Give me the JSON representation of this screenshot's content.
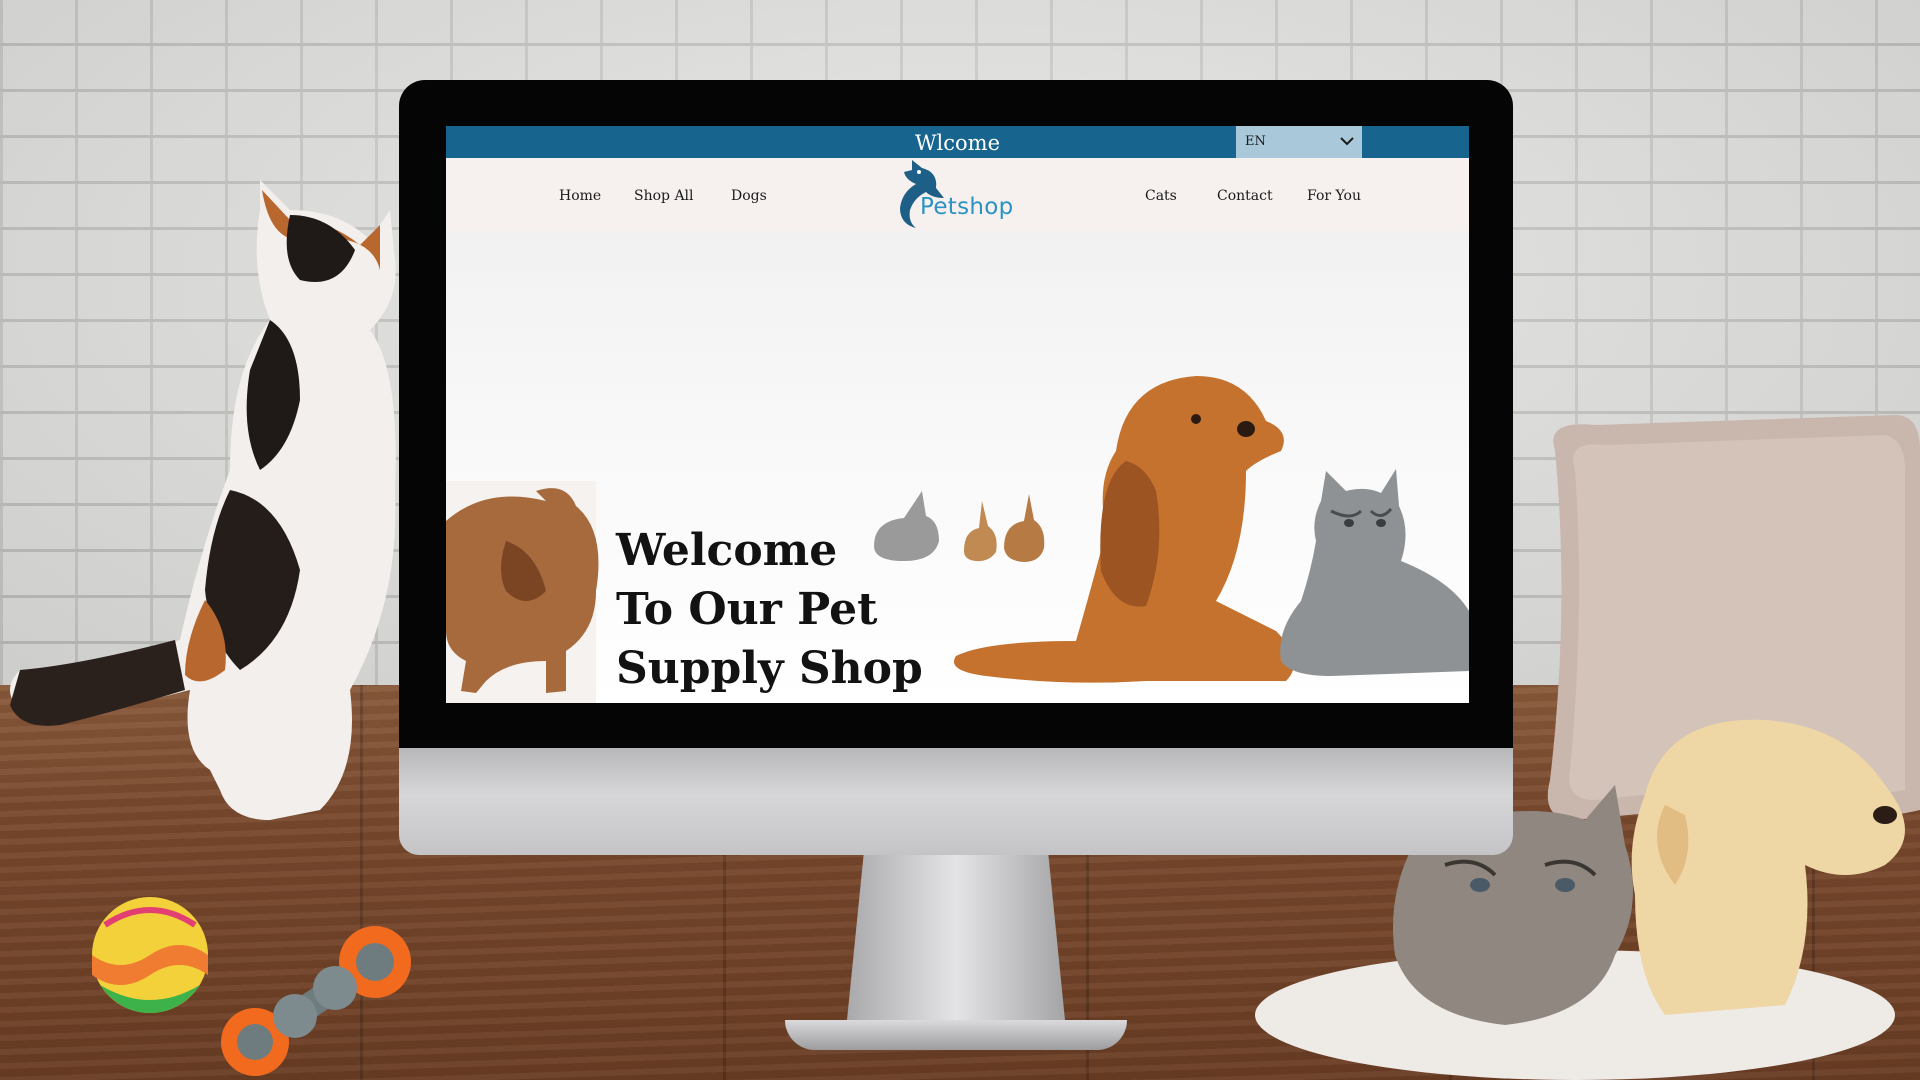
{
  "topbar": {
    "title": "Wlcome"
  },
  "language": {
    "selected": "EN"
  },
  "nav": {
    "left": [
      "Home",
      "Shop All",
      "Dogs"
    ],
    "right": [
      "Cats",
      "Contact",
      "For You"
    ]
  },
  "logo": {
    "text": "Petshop"
  },
  "hero": {
    "lines": [
      "Welcome",
      "To Our Pet",
      "Supply Shop"
    ]
  },
  "colors": {
    "topbar": "#17658f",
    "logo": "#2b93c2",
    "navbar": "#f6f0ef",
    "lang_select": "#a9c9da"
  },
  "icons": [
    "chevron-down-icon",
    "petshop-logo-icon"
  ]
}
